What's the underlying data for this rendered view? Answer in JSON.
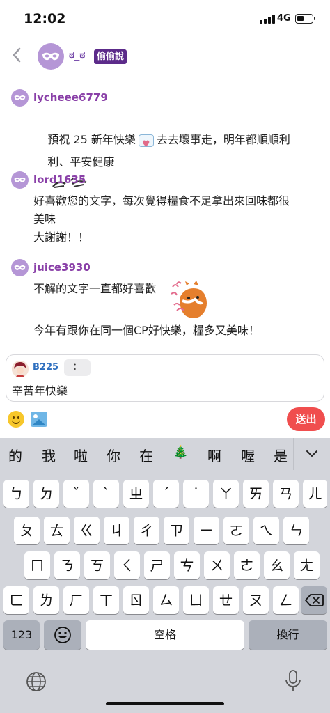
{
  "status": {
    "time": "12:02",
    "network": "4G"
  },
  "header": {
    "back_icon": "chevron-left-icon",
    "name": "ಠ_ಠ",
    "badge": "偷偷說"
  },
  "messages": [
    {
      "user": "lycheee6779",
      "lines": [
        "預祝 25 新年快樂",
        "去去壞事走，明年都順順利",
        "利、平安健康"
      ]
    },
    {
      "user": "lord1635",
      "lines": [
        "好喜歡您的文字，每次覺得糧食不足拿出來回味都很",
        "美味",
        "大謝謝！！"
      ]
    },
    {
      "user": "juice3930",
      "lines": [
        "不解的文字一直都好喜歡",
        "今年有跟你在同一個CP好快樂，糧多又美味！"
      ]
    }
  ],
  "composer": {
    "reply_user": "B225",
    "reply_quote": "：",
    "input_value": "辛苦年快樂",
    "send_label": "送出"
  },
  "keyboard": {
    "candidates": [
      "的",
      "我",
      "啦",
      "你",
      "在",
      "🎄",
      "啊",
      "喔",
      "是"
    ],
    "collapse": "⌄",
    "row1": [
      "ㄅ",
      "ㄉ",
      "ˇ",
      "ˋ",
      "ㄓ",
      "ˊ",
      "˙",
      "ㄚ",
      "ㄞ",
      "ㄢ",
      "ㄦ"
    ],
    "row2": [
      "ㄆ",
      "ㄊ",
      "ㄍ",
      "ㄐ",
      "ㄔ",
      "ㄗ",
      "ㄧ",
      "ㄛ",
      "ㄟ",
      "ㄣ"
    ],
    "row3": [
      "ㄇ",
      "ㄋ",
      "ㄎ",
      "ㄑ",
      "ㄕ",
      "ㄘ",
      "ㄨ",
      "ㄜ",
      "ㄠ",
      "ㄤ"
    ],
    "row4": [
      "ㄈ",
      "ㄌ",
      "ㄏ",
      "ㄒ",
      "ㄖ",
      "ㄙ",
      "ㄩ",
      "ㄝ",
      "ㄡ",
      "ㄥ"
    ],
    "numbers_label": "123",
    "space_label": "空格",
    "return_label": "換行"
  },
  "colors": {
    "accent_purple": "#8a40a8",
    "send_red": "#f04e4e",
    "mask_purple": "#b596d6"
  }
}
